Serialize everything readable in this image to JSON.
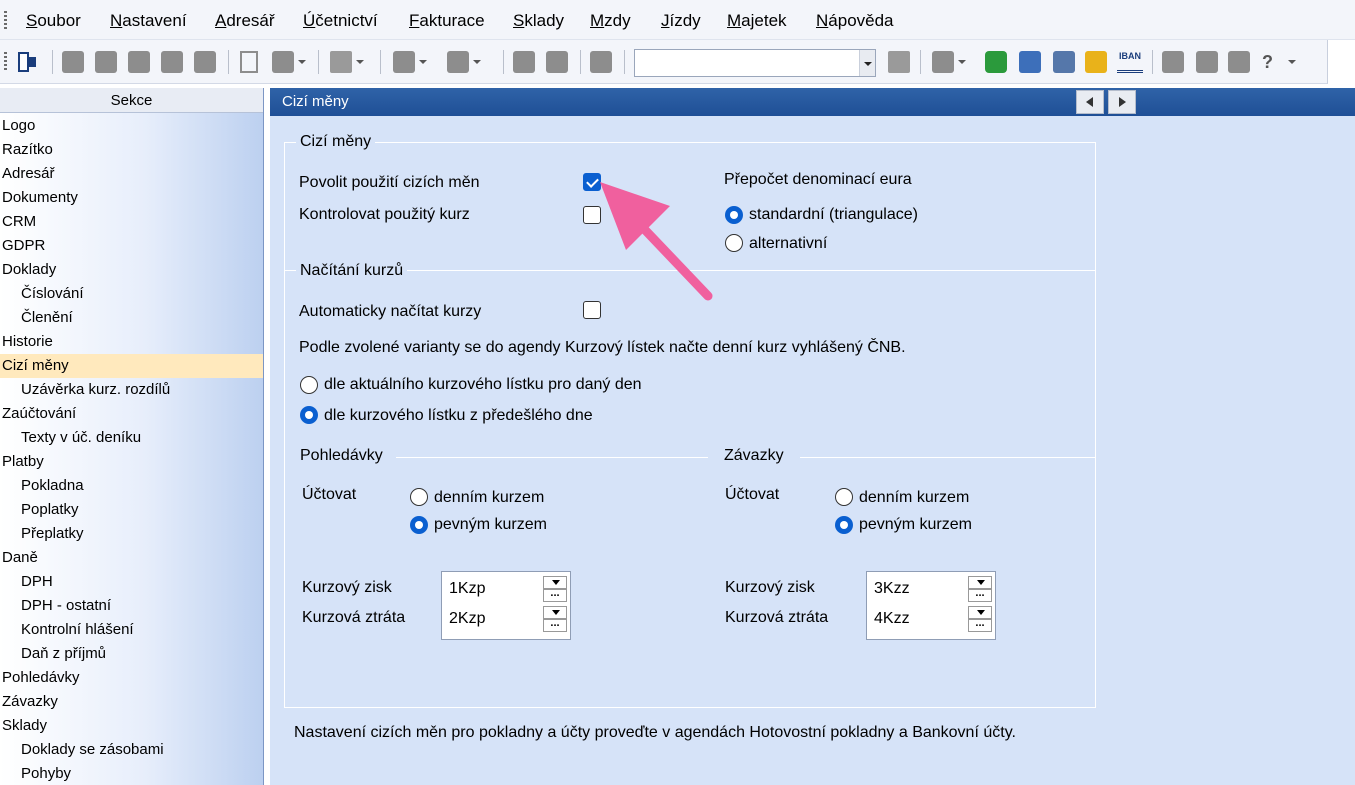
{
  "menu": [
    {
      "label": "Soubor"
    },
    {
      "label": "Nastavení"
    },
    {
      "label": "Adresář"
    },
    {
      "label": "Účetnictví"
    },
    {
      "label": "Fakturace"
    },
    {
      "label": "Sklady"
    },
    {
      "label": "Mzdy"
    },
    {
      "label": "Jízdy"
    },
    {
      "label": "Majetek"
    },
    {
      "label": "Nápověda"
    }
  ],
  "toolbar": {
    "iban_label": "IBAN",
    "combo_value": "",
    "help_label": "?"
  },
  "sidebar": {
    "header": "Sekce",
    "items": [
      {
        "label": "Logo",
        "level": 0
      },
      {
        "label": "Razítko",
        "level": 0
      },
      {
        "label": "Adresář",
        "level": 0
      },
      {
        "label": "Dokumenty",
        "level": 0
      },
      {
        "label": "CRM",
        "level": 0
      },
      {
        "label": "GDPR",
        "level": 0
      },
      {
        "label": "Doklady",
        "level": 0
      },
      {
        "label": "Číslování",
        "level": 1
      },
      {
        "label": "Členění",
        "level": 1
      },
      {
        "label": "Historie",
        "level": 0
      },
      {
        "label": "Cizí měny",
        "level": 0,
        "active": true
      },
      {
        "label": "Uzávěrka kurz. rozdílů",
        "level": 1
      },
      {
        "label": "Zaúčtování",
        "level": 0
      },
      {
        "label": "Texty v úč. deníku",
        "level": 1
      },
      {
        "label": "Platby",
        "level": 0
      },
      {
        "label": "Pokladna",
        "level": 1
      },
      {
        "label": "Poplatky",
        "level": 1
      },
      {
        "label": "Přeplatky",
        "level": 1
      },
      {
        "label": "Daně",
        "level": 0
      },
      {
        "label": "DPH",
        "level": 1
      },
      {
        "label": "DPH - ostatní",
        "level": 1
      },
      {
        "label": "Kontrolní hlášení",
        "level": 1
      },
      {
        "label": "Daň z příjmů",
        "level": 1
      },
      {
        "label": "Pohledávky",
        "level": 0
      },
      {
        "label": "Závazky",
        "level": 0
      },
      {
        "label": "Sklady",
        "level": 0
      },
      {
        "label": "Doklady se zásobami",
        "level": 1
      },
      {
        "label": "Pohyby",
        "level": 1
      }
    ]
  },
  "content": {
    "header": "Cizí měny",
    "foreign": {
      "title": "Cizí měny",
      "allow_label": "Povolit použití cizích měn",
      "allow_checked": true,
      "control_label": "Kontrolovat použitý kurz",
      "control_checked": false,
      "euro_title": "Přepočet denominací eura",
      "euro_options": [
        "standardní  (triangulace)",
        "alternativní"
      ],
      "euro_selected": 0
    },
    "rates": {
      "title": "Načítání kurzů",
      "auto_label": "Automaticky načítat kurzy",
      "auto_checked": false,
      "info": "Podle zvolené varianty se do agendy Kurzový lístek načte denní kurz vyhlášený ČNB.",
      "options": [
        "dle aktuálního kurzového lístku pro daný den",
        "dle kurzového lístku z předešlého dne"
      ],
      "selected": 1
    },
    "receivables": {
      "title": "Pohledávky",
      "account_label": "Účtovat",
      "options": [
        "denním kurzem",
        "pevným kurzem"
      ],
      "selected": 1,
      "gain_label": "Kurzový zisk",
      "gain_value": "1Kzp",
      "loss_label": "Kurzová ztráta",
      "loss_value": "2Kzp"
    },
    "payables": {
      "title": "Závazky",
      "account_label": "Účtovat",
      "options": [
        "denním kurzem",
        "pevným kurzem"
      ],
      "selected": 1,
      "gain_label": "Kurzový zisk",
      "gain_value": "3Kzz",
      "loss_label": "Kurzová ztráta",
      "loss_value": "4Kzz"
    },
    "footer_note": "Nastavení cizích měn pro pokladny a účty proveďte v agendách Hotovostní pokladny a Bankovní účty."
  },
  "colors": {
    "accent_blue": "#0a5fd0",
    "header_blue": "#245597",
    "active_item": "#ffe9bd",
    "panel_bg": "#d6e3f8",
    "annotation_arrow": "#f0609e"
  }
}
